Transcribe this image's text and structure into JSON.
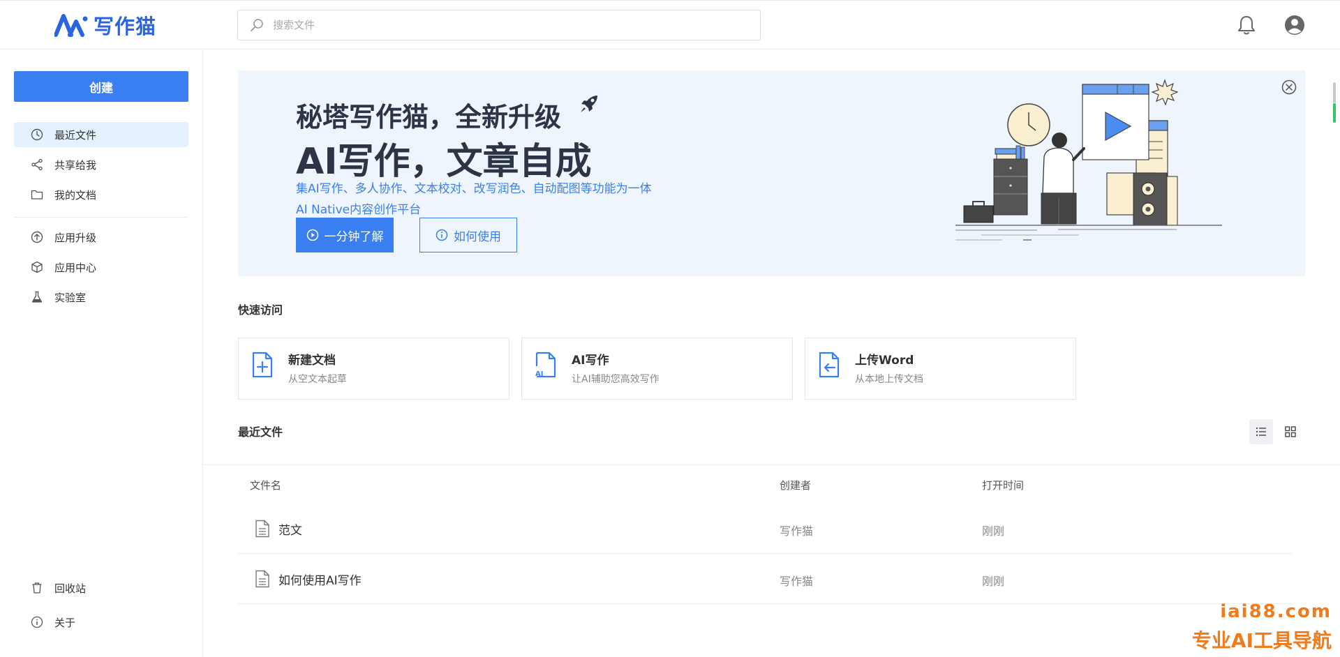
{
  "app": {
    "brand": "写作猫",
    "search_placeholder": "搜索文件",
    "brand_color": "#2a64e0",
    "accent_color": "#3a7ff2"
  },
  "sidebar": {
    "create_label": "创建",
    "items": [
      {
        "label": "最近文件",
        "icon": "clock-icon",
        "active": true
      },
      {
        "label": "共享给我",
        "icon": "share-icon"
      },
      {
        "label": "我的文档",
        "icon": "folder-icon"
      },
      {
        "label": "应用升级",
        "icon": "upgrade-icon"
      },
      {
        "label": "应用中心",
        "icon": "cube-icon"
      },
      {
        "label": "实验室",
        "icon": "flask-icon"
      }
    ],
    "bottom_items": [
      {
        "label": "回收站",
        "icon": "trash-icon"
      },
      {
        "label": "关于",
        "icon": "info-icon"
      }
    ]
  },
  "banner": {
    "title_line1": "秘塔写作猫，全新升级",
    "title_line2": "AI写作，文章自成",
    "subtitle_line1": "集AI写作、多人协作、文本校对、改写润色、自动配图等功能为一体",
    "subtitle_line2": "AI Native内容创作平台",
    "primary_button": "一分钟了解",
    "secondary_button": "如何使用"
  },
  "quick_access": {
    "title": "快速访问",
    "cards": [
      {
        "title": "新建文档",
        "subtitle": "从空文本起草",
        "icon": "new-doc-icon"
      },
      {
        "title": "AI写作",
        "subtitle": "让AI辅助您高效写作",
        "icon": "ai-doc-icon"
      },
      {
        "title": "上传Word",
        "subtitle": "从本地上传文档",
        "icon": "upload-doc-icon"
      }
    ]
  },
  "recent": {
    "title": "最近文件",
    "columns": {
      "name": "文件名",
      "creator": "创建者",
      "time": "打开时间"
    },
    "rows": [
      {
        "name": "范文",
        "creator": "写作猫",
        "time": "刚刚"
      },
      {
        "name": "如何使用AI写作",
        "creator": "写作猫",
        "time": "刚刚"
      }
    ]
  },
  "watermark": {
    "line1": "iai88.com",
    "line2": "专业AI工具导航"
  }
}
